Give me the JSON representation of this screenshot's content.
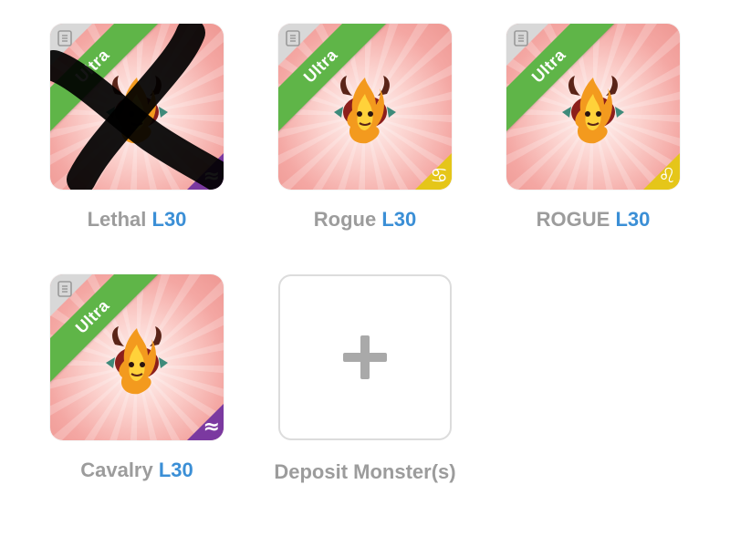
{
  "monsters": [
    {
      "name": "Lethal",
      "level": "L30",
      "rarity": "Ultra",
      "badge_icon": "approx-equal-icon",
      "badge_glyph": "≈",
      "badge_color": "#7b3aa0",
      "crossed_out": true
    },
    {
      "name": "Rogue",
      "level": "L30",
      "rarity": "Ultra",
      "badge_icon": "cancer-zodiac-icon",
      "badge_glyph": "♋",
      "badge_color": "#e5c51a",
      "crossed_out": false
    },
    {
      "name": "ROGUE",
      "level": "L30",
      "rarity": "Ultra",
      "badge_icon": "leo-zodiac-icon",
      "badge_glyph": "♌",
      "badge_color": "#e5c51a",
      "crossed_out": false
    },
    {
      "name": "Cavalry",
      "level": "L30",
      "rarity": "Ultra",
      "badge_icon": "approx-equal-icon",
      "badge_glyph": "≈",
      "badge_color": "#7b3aa0",
      "crossed_out": false
    }
  ],
  "deposit": {
    "label": "Deposit Monster(s)",
    "icon": "plus-icon"
  },
  "colors": {
    "rarity_ribbon": "#5fb548",
    "level_text": "#3b8fd6",
    "name_text": "#9c9c9c"
  }
}
